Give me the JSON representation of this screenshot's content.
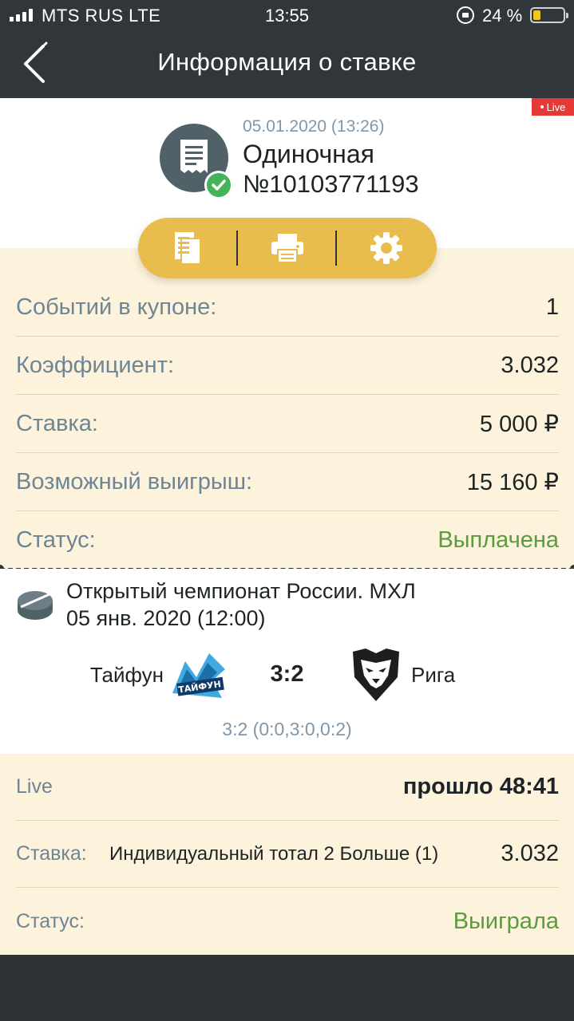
{
  "status_bar": {
    "carrier": "MTS RUS LTE",
    "time": "13:55",
    "battery_pct": "24 %",
    "battery_level": 0.24
  },
  "nav": {
    "title": "Информация о ставке"
  },
  "header": {
    "live_badge": "Live",
    "date": "05.01.2020 (13:26)",
    "type": "Одиночная",
    "number": "№10103771193"
  },
  "details": [
    {
      "label": "Событий в купоне:",
      "value": "1"
    },
    {
      "label": "Коэффициент:",
      "value": "3.032"
    },
    {
      "label": "Ставка:",
      "value": "5 000 ₽"
    },
    {
      "label": "Возможный выигрыш:",
      "value": "15 160 ₽"
    },
    {
      "label": "Статус:",
      "value": "Выплачена"
    }
  ],
  "event": {
    "tournament": "Открытый чемпионат России. МХЛ",
    "date": "05 янв. 2020 (12:00)",
    "team1": "Тайфун",
    "team1_logo_text": "ТАЙФУН",
    "score": "3:2",
    "team2": "Рига",
    "period_score": "3:2 (0:0,3:0,0:2)"
  },
  "bet_info": {
    "live_label": "Live",
    "live_value": "прошло 48:41",
    "bet_label": "Ставка:",
    "bet_market": "Индивидуальный тотал 2 Больше (1)",
    "bet_odds": "3.032",
    "status_label": "Статус:",
    "status_value": "Выиграла"
  },
  "colors": {
    "dark": "#30363a",
    "cream": "#fdf3dc",
    "accent_yellow": "#e8bc4d",
    "green": "#5b9a3f",
    "muted_label": "#6e8594",
    "live_red": "#e53935"
  },
  "icons": [
    "back-chevron-icon",
    "receipt-icon",
    "check-icon",
    "documents-icon",
    "printer-icon",
    "gear-icon",
    "hockey-puck-icon"
  ]
}
